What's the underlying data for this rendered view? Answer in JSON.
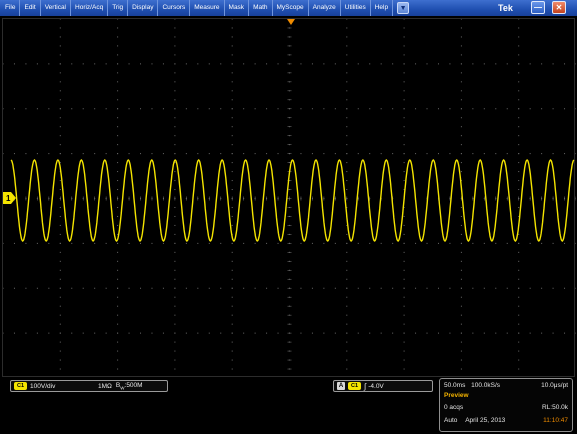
{
  "menubar": {
    "items": [
      "File",
      "Edit",
      "Vertical",
      "Horiz/Acq",
      "Trig",
      "Display",
      "Cursors",
      "Measure",
      "Mask",
      "Math",
      "MyScope",
      "Analyze",
      "Utilities",
      "Help"
    ],
    "brand": "Tek",
    "dropdown_glyph": "▼",
    "minimize_glyph": "—",
    "close_glyph": "✕"
  },
  "screen": {
    "grid_color": "#6a6a6a",
    "trace_color": "#f4e400",
    "marker_color": "#f08c00",
    "channel_marker": "1",
    "waveform": {
      "cycles": 24,
      "amplitude_fraction_of_half_div": 0.92
    }
  },
  "channel_readout": {
    "badge": "C1",
    "scale": "100V/div",
    "coupling": "1MΩ",
    "bw_prefix": "B",
    "bw_sub": "W",
    "bandwidth": ":500M"
  },
  "trigger_readout": {
    "mode_badge": "A",
    "source_badge": "C1",
    "slope_icon": "∫",
    "level": "-4.0V"
  },
  "acquisition": {
    "timebase": "50.0ms",
    "sample_rate": "100.0kS/s",
    "resolution": "10.0μs/pt",
    "status": "Preview",
    "acqs": "0 acqs",
    "record_length": "RL:50.0k",
    "trigger_mode": "Auto",
    "date": "April 25, 2013",
    "time": "11:10:47",
    "status_color": "#f4b400",
    "time_color": "#f08c00"
  }
}
